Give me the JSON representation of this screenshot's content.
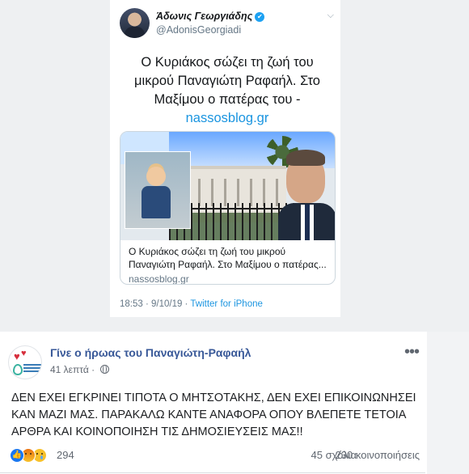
{
  "tweet": {
    "author_name": "Άδωνις Γεωργιάδης",
    "author_handle": "@AdonisGeorgiadi",
    "verified_glyph": "✔",
    "text_main": "Ο Κυριάκος σώζει τη ζωή του μικρού Παναγιώτη Ραφαήλ. Στο Μαξίμου ο πατέρας του - ",
    "text_link": "nassosblog.gr",
    "card": {
      "title": "Ο Κυριάκος σώζει τη ζωή του μικρού Παναγιώτη Ραφαήλ. Στο Μαξίμου ο πατέρας...",
      "domain": "nassosblog.gr"
    },
    "timestamp": "18:53 · 9/10/19 · ",
    "source": "Twitter for iPhone",
    "chevron_glyph": "⌵"
  },
  "facebook_post": {
    "page_name": "Γίνε ο ήρωας του Παναγιώτη-Ραφαήλ",
    "time": "41 λεπτά · ",
    "more_glyph": "•••",
    "body": "ΔΕΝ ΕΧΕΙ ΕΓΚΡΙΝΕΙ ΤΙΠΟΤΑ Ο ΜΗΤΣΟΤΑΚΗΣ, ΔΕΝ ΕΧΕΙ ΕΠΙΚΟΙΝΩΝΗΣΕΙ ΚΑΝ ΜΑΖΙ ΜΑΣ. ΠΑΡΑΚΑΛΩ ΚΑΝΤΕ ΑΝΑΦΟΡΑ ΟΠΟΥ ΒΛΕΠΕΤΕ ΤΕΤΟΙΑ ΑΡΘΡΑ ΚΑΙ ΚΟΙΝΟΠΟΙΗΣΗ ΤΙΣ ΔΗΜΟΣΙΕΥΣΕΙΣ ΜΑΣ!!",
    "reaction_count": "294",
    "comments": "45 σχόλια",
    "shares": "230 κοινοποιήσεις",
    "like_glyph": "👍"
  }
}
